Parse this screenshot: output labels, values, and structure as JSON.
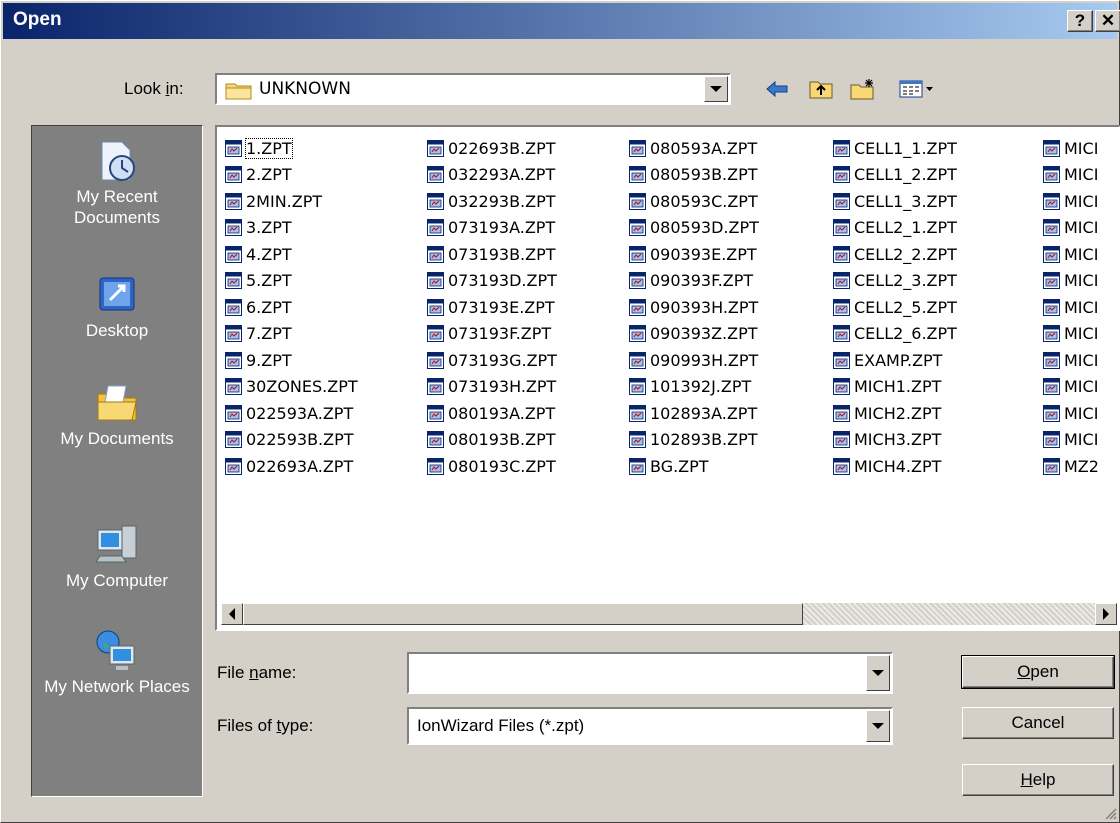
{
  "window": {
    "title": "Open",
    "help_label": "?",
    "close_label": "✕"
  },
  "look_in": {
    "label_pre": "Look ",
    "label_key": "i",
    "label_post": "n:",
    "value": "UNKNOWN"
  },
  "toolbar": {
    "icons": [
      "back-arrow-icon",
      "up-folder-icon",
      "new-folder-icon",
      "view-menu-icon"
    ]
  },
  "places": [
    {
      "label": "My Recent Documents",
      "icon": "recent-documents-icon"
    },
    {
      "label": "Desktop",
      "icon": "desktop-icon"
    },
    {
      "label": "My Documents",
      "icon": "my-documents-icon"
    },
    {
      "label": "My Computer",
      "icon": "my-computer-icon"
    },
    {
      "label": "My Network Places",
      "icon": "network-places-icon"
    }
  ],
  "files": {
    "col1": [
      "1.ZPT",
      "2.ZPT",
      "2MIN.ZPT",
      "3.ZPT",
      "4.ZPT",
      "5.ZPT",
      "6.ZPT",
      "7.ZPT",
      "9.ZPT",
      "30ZONES.ZPT",
      "022593A.ZPT",
      "022593B.ZPT",
      "022693A.ZPT"
    ],
    "col2": [
      "022693B.ZPT",
      "032293A.ZPT",
      "032293B.ZPT",
      "073193A.ZPT",
      "073193B.ZPT",
      "073193D.ZPT",
      "073193E.ZPT",
      "073193F.ZPT",
      "073193G.ZPT",
      "073193H.ZPT",
      "080193A.ZPT",
      "080193B.ZPT",
      "080193C.ZPT"
    ],
    "col3": [
      "080593A.ZPT",
      "080593B.ZPT",
      "080593C.ZPT",
      "080593D.ZPT",
      "090393E.ZPT",
      "090393F.ZPT",
      "090393H.ZPT",
      "090393Z.ZPT",
      "090993H.ZPT",
      "101392J.ZPT",
      "102893A.ZPT",
      "102893B.ZPT",
      "BG.ZPT"
    ],
    "col4": [
      "CELL1_1.ZPT",
      "CELL1_2.ZPT",
      "CELL1_3.ZPT",
      "CELL2_1.ZPT",
      "CELL2_2.ZPT",
      "CELL2_3.ZPT",
      "CELL2_5.ZPT",
      "CELL2_6.ZPT",
      "EXAMP.ZPT",
      "MICH1.ZPT",
      "MICH2.ZPT",
      "MICH3.ZPT",
      "MICH4.ZPT"
    ],
    "col5": [
      "MICI",
      "MICI",
      "MICI",
      "MICI",
      "MICI",
      "MICI",
      "MICI",
      "MICI",
      "MICI",
      "MICI",
      "MICI",
      "MICI",
      "MZ2"
    ]
  },
  "file_name": {
    "label_pre": "File ",
    "label_key": "n",
    "label_post": "ame:",
    "value": ""
  },
  "file_type": {
    "label_pre": "Files of ",
    "label_key": "t",
    "label_post": "ype:",
    "value": "IonWizard Files (*.zpt)"
  },
  "buttons": {
    "open_key": "O",
    "open_rest": "pen",
    "cancel": "Cancel",
    "help_key": "H",
    "help_rest": "elp"
  }
}
